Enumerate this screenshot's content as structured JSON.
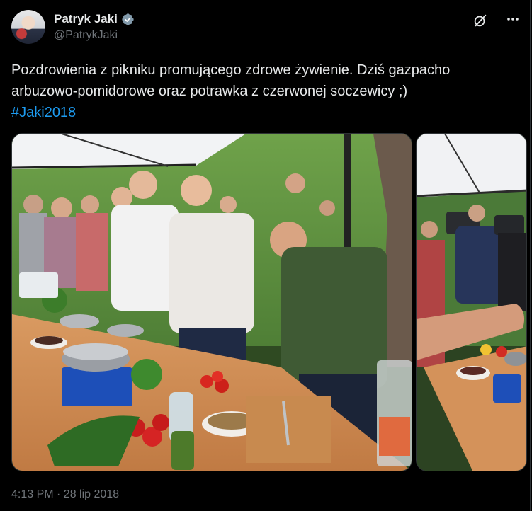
{
  "author": {
    "display_name": "Patryk Jaki",
    "handle": "@PatrykJaki",
    "verified": true
  },
  "icons": {
    "verified": "verified-badge-icon",
    "grok": "grok-icon",
    "more": "more-icon"
  },
  "tweet": {
    "text_line1": "Pozdrowienia z pikniku promującego zdrowe żywienie. Dziś gazpacho",
    "text_line2": "arbuzowo-pomidorowe oraz potrawka z czerwonej soczewicy ;)",
    "hashtag": "#Jaki2018",
    "timestamp": "4:13 PM · 28 lip 2018"
  },
  "colors": {
    "background": "#000000",
    "text": "#e7e9ea",
    "secondary": "#71767b",
    "link": "#1d9bf0",
    "verified": "#829aab"
  }
}
